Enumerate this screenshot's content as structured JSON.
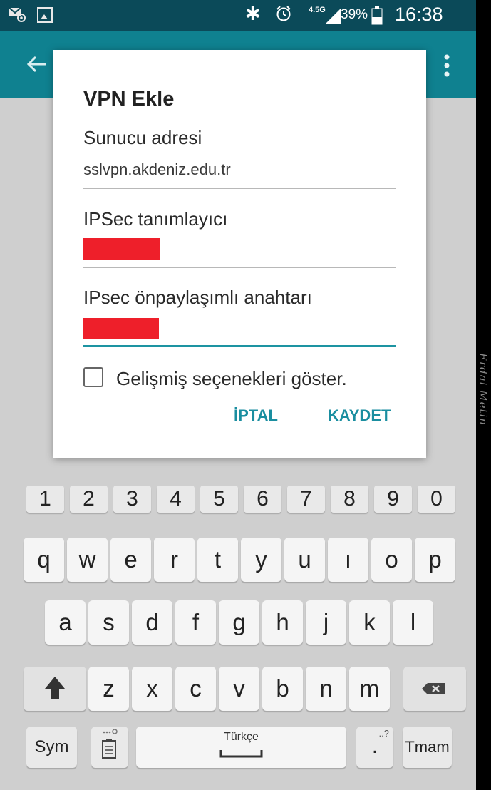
{
  "status_bar": {
    "network": "4.5G",
    "battery": "39%",
    "time": "16:38",
    "icons": [
      "mail-icon",
      "image-icon",
      "bluetooth-icon",
      "alarm-icon",
      "signal-icon",
      "battery-icon"
    ]
  },
  "toolbar": {
    "icons": [
      "back-arrow-icon",
      "overflow-menu-icon"
    ]
  },
  "dialog": {
    "title": "VPN Ekle",
    "server": {
      "label": "Sunucu adresi",
      "value": "sslvpn.akdeniz.edu.tr"
    },
    "ipsec_id": {
      "label": "IPSec tanımlayıcı",
      "redacted": true
    },
    "ipsec_key": {
      "label": "IPsec önpaylaşımlı anahtarı",
      "redacted": true
    },
    "advanced": {
      "label": "Gelişmiş seçenekleri göster.",
      "checked": false
    },
    "cancel_label": "İPTAL",
    "save_label": "KAYDET"
  },
  "keyboard": {
    "number_row": [
      "1",
      "2",
      "3",
      "4",
      "5",
      "6",
      "7",
      "8",
      "9",
      "0"
    ],
    "row1": [
      "q",
      "w",
      "e",
      "r",
      "t",
      "y",
      "u",
      "ı",
      "o",
      "p"
    ],
    "row2": [
      "a",
      "s",
      "d",
      "f",
      "g",
      "h",
      "j",
      "k",
      "l"
    ],
    "row3": [
      "z",
      "x",
      "c",
      "v",
      "b",
      "n",
      "m"
    ],
    "sym_label": "Sym",
    "space_label": "Türkçe",
    "dot_label": ".",
    "dot_hint": "..?",
    "done_label": "Tmam"
  },
  "watermark": "Erdal Metin",
  "colors": {
    "status_bar": "#0b4a59",
    "toolbar": "#0f8190",
    "accent": "#1a8ea0",
    "redaction": "#ee1f2a"
  }
}
